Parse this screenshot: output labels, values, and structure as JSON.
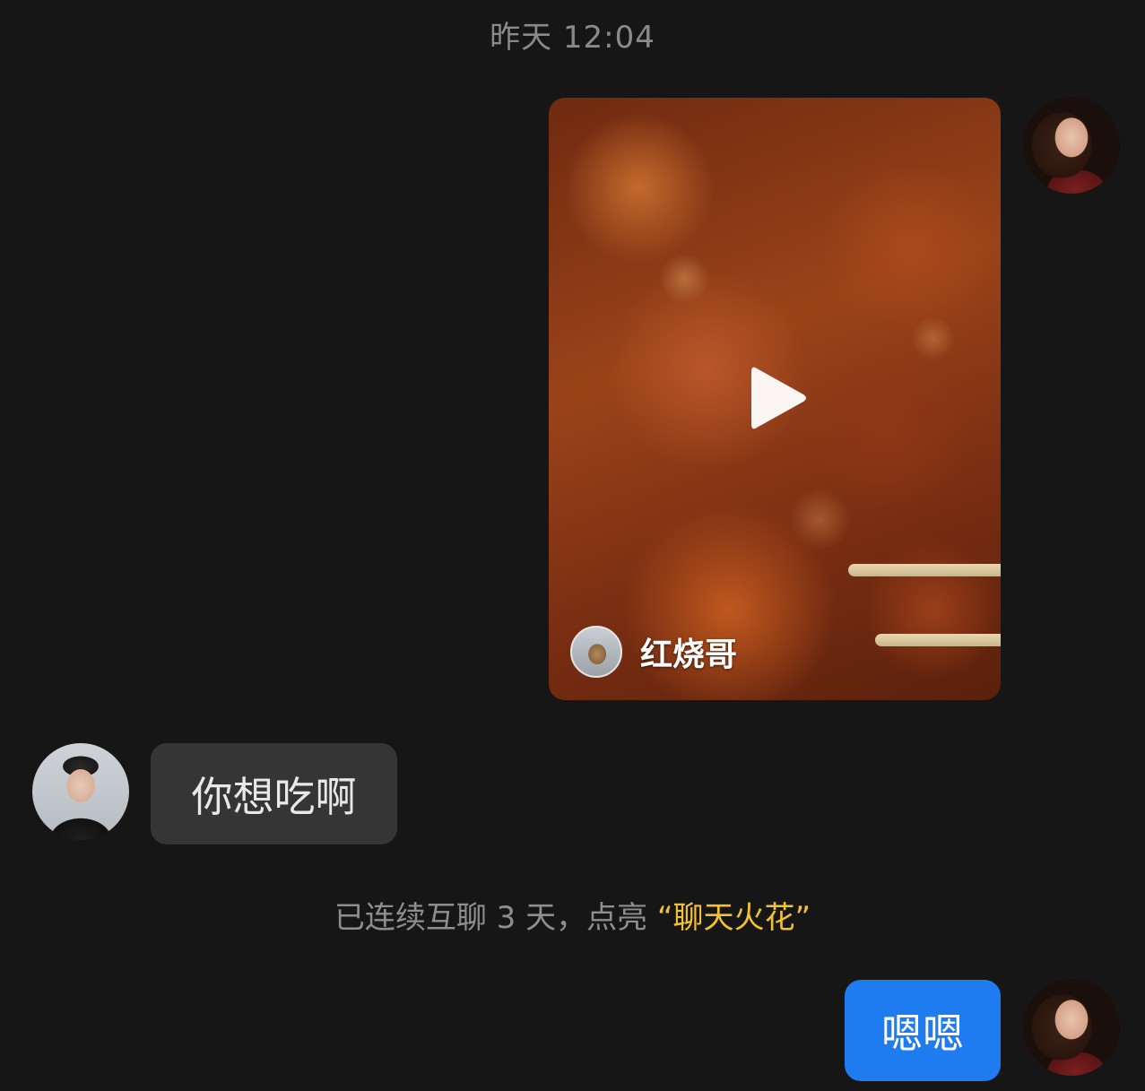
{
  "timestamp": "昨天 12:04",
  "messages": {
    "video_card": {
      "author_name": "红烧哥"
    },
    "left_text": "你想吃啊",
    "right_text": "嗯嗯"
  },
  "system_note": {
    "prefix": "已连续互聊 3 天，点亮 ",
    "highlight": "“聊天火花”"
  },
  "colors": {
    "background": "#161616",
    "sent_bubble": "#1e7cf0",
    "received_bubble": "#353535",
    "highlight": "#f2c230"
  },
  "icons": {
    "play": "play-icon"
  }
}
